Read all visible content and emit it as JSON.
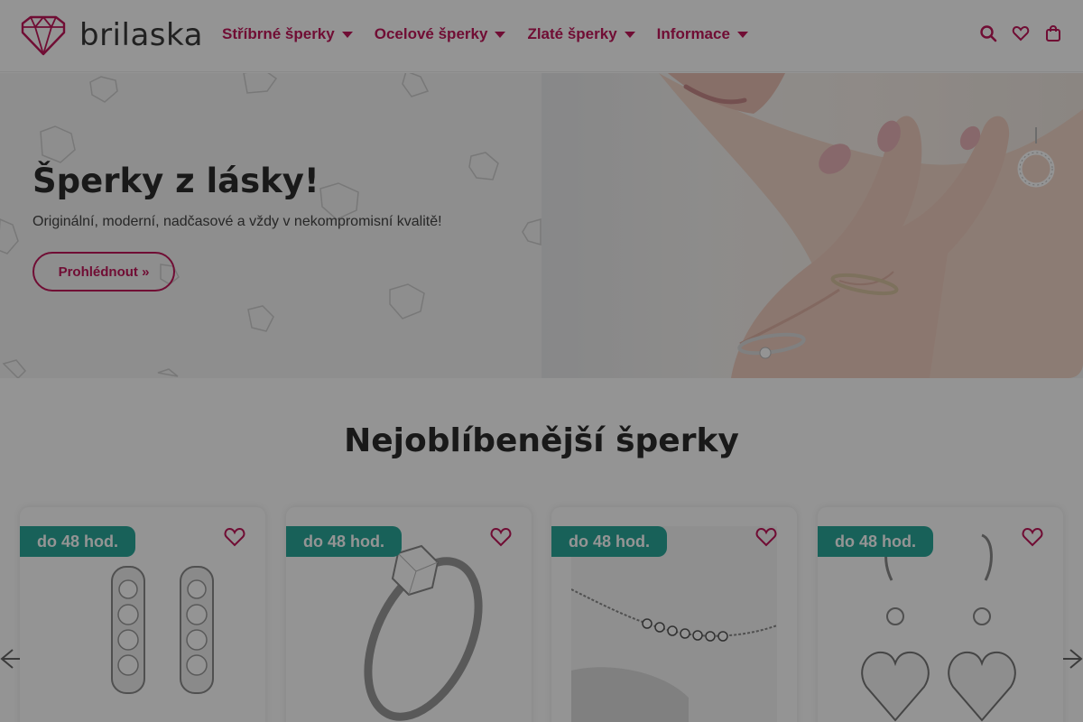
{
  "brand": {
    "name": "brilaska",
    "color": "#c2185b"
  },
  "nav": {
    "items": [
      {
        "label": "Stříbrné šperky"
      },
      {
        "label": "Ocelové šperky"
      },
      {
        "label": "Zlaté šperky"
      },
      {
        "label": "Informace"
      }
    ]
  },
  "header_icons": [
    "search-icon",
    "heart-icon",
    "shopping-bag-icon"
  ],
  "hero": {
    "title": "Šperky z lásky!",
    "subtitle": "Originální, moderní, nadčasové a vždy v nekompromisní kvalitě!",
    "button_label": "Prohlédnout »"
  },
  "section": {
    "title": "Nejoblíbenější šperky"
  },
  "products": [
    {
      "badge": "do 48 hod.",
      "kind": "earrings-hoops"
    },
    {
      "badge": "do 48 hod.",
      "kind": "ring"
    },
    {
      "badge": "do 48 hod.",
      "kind": "bracelet"
    },
    {
      "badge": "do 48 hod.",
      "kind": "earrings-hearts"
    }
  ],
  "colors": {
    "accent": "#c2185b",
    "badge": "#2aa89a",
    "text": "#2b2b2b"
  }
}
